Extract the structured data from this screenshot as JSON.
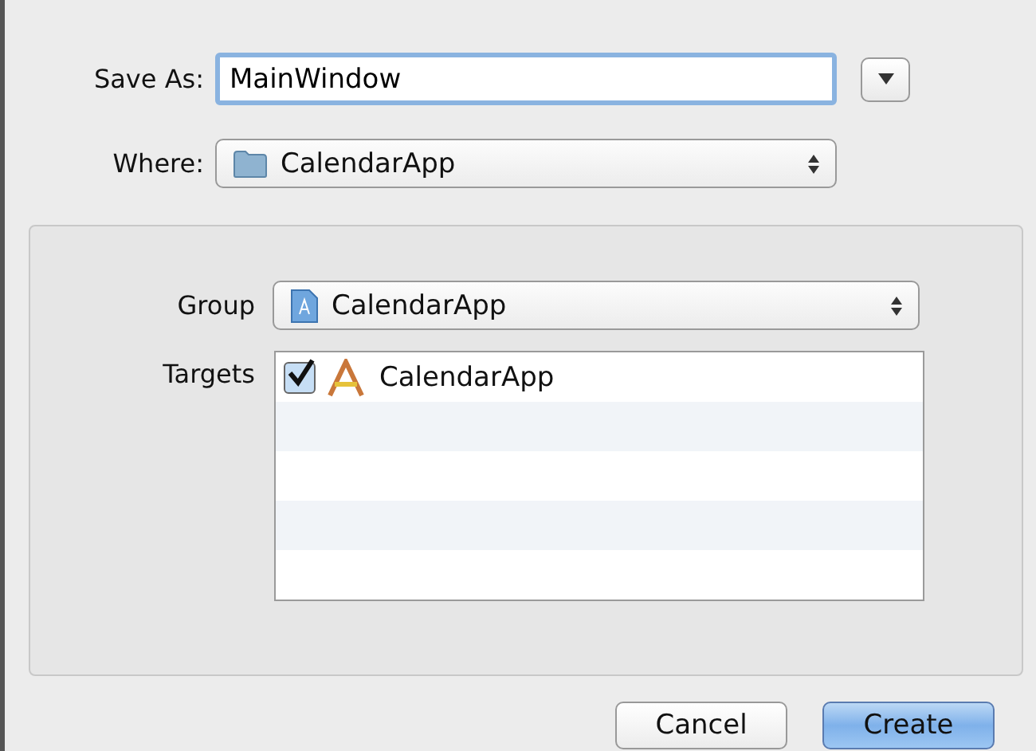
{
  "save_as": {
    "label": "Save As:",
    "value": "MainWindow"
  },
  "where": {
    "label": "Where:",
    "value": "CalendarApp"
  },
  "group": {
    "label": "Group",
    "value": "CalendarApp"
  },
  "targets": {
    "label": "Targets",
    "rows": [
      {
        "name": "CalendarApp",
        "checked": true
      }
    ]
  },
  "buttons": [
    {
      "label": "Cancel",
      "kind": "normal"
    },
    {
      "label": "Create",
      "kind": "default"
    }
  ]
}
